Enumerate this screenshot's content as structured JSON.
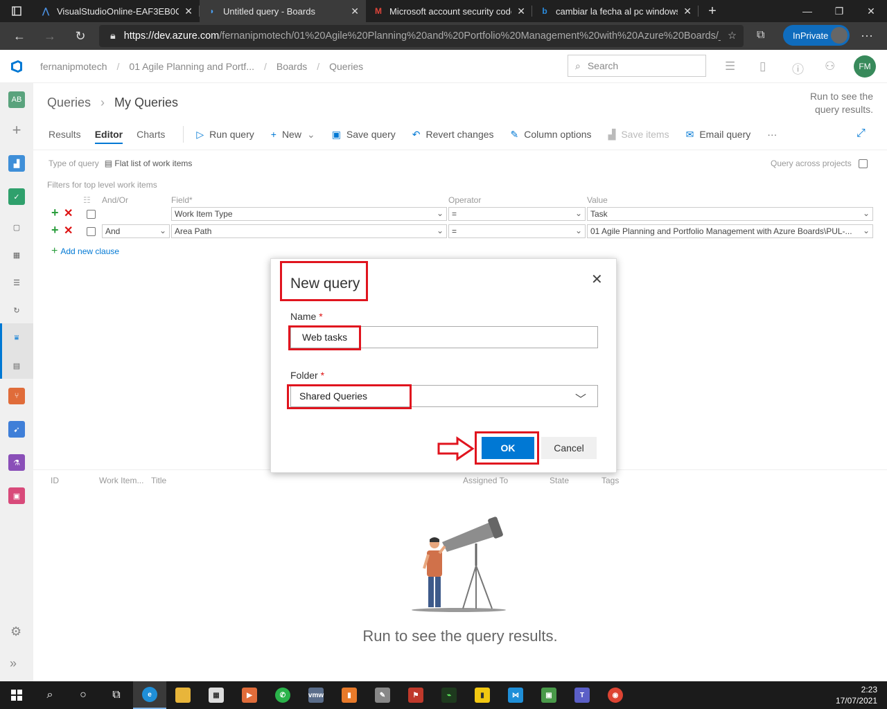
{
  "browser": {
    "tabs": [
      {
        "title": "VisualStudioOnline-EAF3EB0C32",
        "favicon": "visualstudio-icon",
        "active": false
      },
      {
        "title": "Untitled query - Boards",
        "favicon": "azure-devops-icon",
        "active": true
      },
      {
        "title": "Microsoft account security code",
        "favicon": "gmail-icon",
        "active": false
      },
      {
        "title": "cambiar la fecha al pc windows 1",
        "favicon": "bing-icon",
        "active": false
      }
    ],
    "url_host": "https://dev.azure.com",
    "url_path": "/fernanipmotech/01%20Agile%20Planning%20and%20Portfolio%20Management%20with%20Azure%20Boards/_...",
    "inprivate_label": "InPrivate"
  },
  "header": {
    "breadcrumbs": [
      "fernanipmotech",
      "01 Agile Planning and Portf...",
      "Boards",
      "Queries"
    ],
    "search_placeholder": "Search",
    "user_initials": "FM"
  },
  "leftnav": {
    "project_initials": "AB"
  },
  "page": {
    "title_root": "Queries",
    "title_current": "My Queries",
    "run_hint": "Run to see the query results."
  },
  "toolbar": {
    "tabs": [
      "Results",
      "Editor",
      "Charts"
    ],
    "active_tab": "Editor",
    "run_query": "Run query",
    "new": "New",
    "save_query": "Save query",
    "revert_changes": "Revert changes",
    "column_options": "Column options",
    "save_items": "Save items",
    "email_query": "Email query",
    "more": "···"
  },
  "query": {
    "type_label": "Type of query",
    "type_value": "Flat list of work items",
    "across_projects": "Query across projects",
    "filters_label": "Filters for top level work items",
    "columns": {
      "andor": "And/Or",
      "field": "Field*",
      "operator": "Operator",
      "value": "Value"
    },
    "clauses": [
      {
        "andor": "",
        "field": "Work Item Type",
        "operator": "=",
        "value": "Task"
      },
      {
        "andor": "And",
        "field": "Area Path",
        "operator": "=",
        "value": "01 Agile Planning and Portfolio Management with Azure Boards\\PUL-..."
      }
    ],
    "add_clause": "Add new clause"
  },
  "results": {
    "columns": [
      "ID",
      "Work Item...",
      "Title",
      "Assigned To",
      "State",
      "Tags"
    ],
    "empty_message": "Run to see the query results."
  },
  "dialog": {
    "title": "New query",
    "name_label": "Name",
    "name_value": "Web tasks",
    "folder_label": "Folder",
    "folder_value": "Shared Queries",
    "required_mark": "*",
    "ok": "OK",
    "cancel": "Cancel"
  },
  "taskbar": {
    "time": "2:23",
    "date": "17/07/2021"
  },
  "colors": {
    "accent": "#0078d4",
    "highlight": "#e0141e",
    "add": "#2a9d3c",
    "delete": "#dd1111"
  }
}
